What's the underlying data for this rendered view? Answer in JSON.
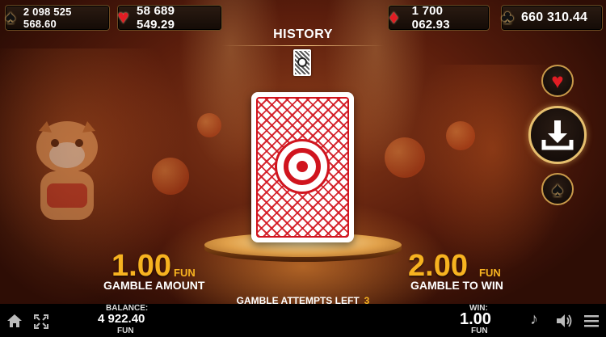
{
  "jackpots": [
    {
      "suit": "spade-icon",
      "symbol": "♠",
      "color": "black",
      "value": "2 098 525 568.60"
    },
    {
      "suit": "heart-icon",
      "symbol": "♥",
      "color": "red",
      "value": "58 689 549.29"
    },
    {
      "suit": "diamond-icon",
      "symbol": "♦",
      "color": "red",
      "value": "1 700 062.93"
    },
    {
      "suit": "club-icon",
      "symbol": "♣",
      "color": "black",
      "value": "660 310.44"
    }
  ],
  "history": {
    "title": "HISTORY"
  },
  "gamble_amount": {
    "value": "1.00",
    "unit": "FUN",
    "label": "GAMBLE AMOUNT"
  },
  "gamble_to_win": {
    "value": "2.00",
    "unit": "FUN",
    "label": "GAMBLE TO WIN"
  },
  "attempts": {
    "label": "GAMBLE ATTEMPTS LEFT",
    "value": "3"
  },
  "balance": {
    "label": "BALANCE:",
    "value": "4 922.40",
    "unit": "FUN"
  },
  "win": {
    "label": "WIN:",
    "value": "1.00",
    "unit": "FUN"
  },
  "colors": {
    "accent": "#f7b320",
    "card_red": "#d0141e",
    "gold_border": "#c99a4a"
  }
}
